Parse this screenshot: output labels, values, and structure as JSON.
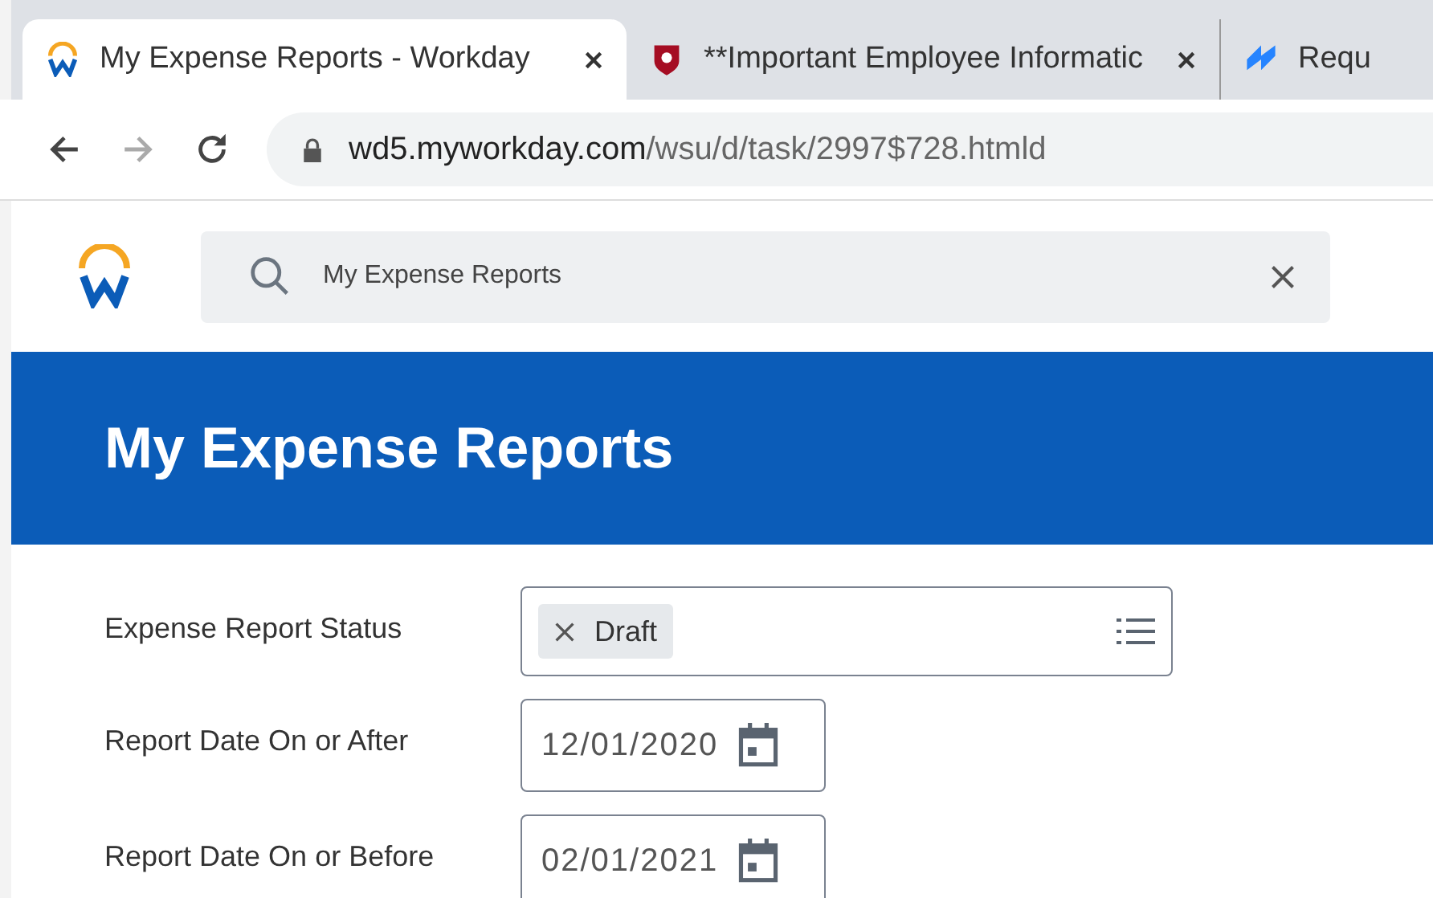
{
  "browser": {
    "tabs": [
      {
        "title": "My Expense Reports - Workday",
        "selected": true,
        "closable": true
      },
      {
        "title": "**Important Employee Informatic",
        "selected": false,
        "closable": true
      },
      {
        "title": "Requ",
        "selected": false,
        "closable": false
      }
    ],
    "url": {
      "host": "wd5.myworkday.com",
      "path": "/wsu/d/task/2997$728.htmld"
    }
  },
  "search": {
    "value": "My Expense Reports"
  },
  "banner": {
    "title": "My Expense Reports"
  },
  "fields": [
    {
      "kind": "multiselect",
      "label": "Expense Report Status",
      "chips": [
        "Draft"
      ]
    },
    {
      "kind": "date",
      "label": "Report Date On or After",
      "value": "12/01/2020"
    },
    {
      "kind": "date",
      "label": "Report Date On or Before",
      "value": "02/01/2021"
    }
  ]
}
